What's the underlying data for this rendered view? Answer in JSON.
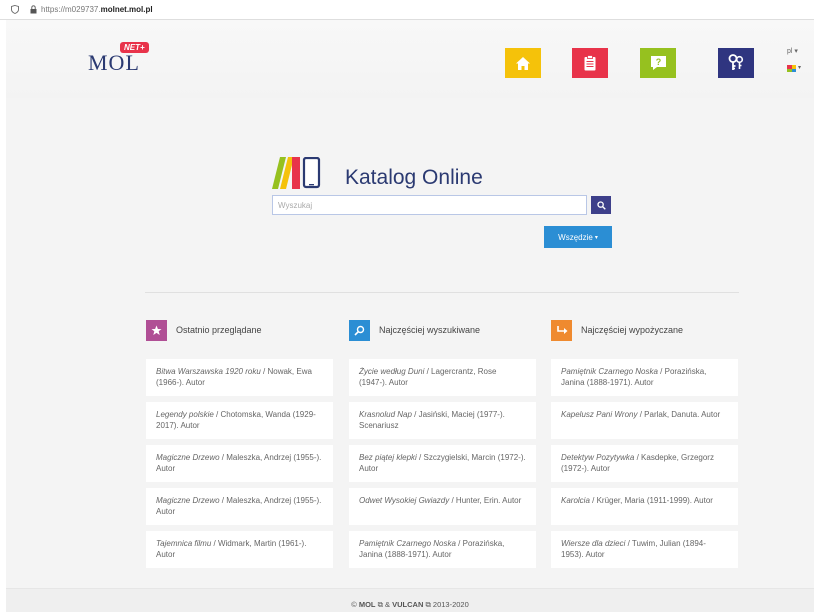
{
  "browser": {
    "url_prefix": "https://m029737.",
    "url_domain": "molnet.mol.pl"
  },
  "header": {
    "logo_text": "MOL",
    "logo_badge": "NET+",
    "language": "pl ▾"
  },
  "catalog": {
    "title": "Katalog Online",
    "search_placeholder": "Wyszukaj",
    "search_value": "",
    "scope_label": "Wszędzie",
    "scope_caret": "▾"
  },
  "sections": [
    {
      "title": "Ostatnio przeglądane",
      "icon": "star-icon",
      "color": "#b04f95",
      "items": [
        {
          "title": "Bitwa Warszawska 1920 roku",
          "rest": " / Nowak, Ewa (1966-). Autor"
        },
        {
          "title": "Legendy polskie",
          "rest": " / Chotomska, Wanda (1929-2017). Autor"
        },
        {
          "title": "Magiczne Drzewo",
          "rest": " / Maleszka, Andrzej (1955-). Autor"
        },
        {
          "title": "Magiczne Drzewo",
          "rest": " / Maleszka, Andrzej (1955-). Autor"
        },
        {
          "title": "Tajemnica filmu",
          "rest": " / Widmark, Martin (1961-). Autor"
        }
      ]
    },
    {
      "title": "Najczęściej wyszukiwane",
      "icon": "search-icon",
      "color": "#2b8ed4",
      "items": [
        {
          "title": "Życie według Duni",
          "rest": " / Lagercrantz, Rose (1947-). Autor"
        },
        {
          "title": "Krasnolud Nap",
          "rest": " / Jasiński, Maciej (1977-). Scenariusz"
        },
        {
          "title": "Bez piątej klepki",
          "rest": " / Szczygielski, Marcin (1972-). Autor"
        },
        {
          "title": "Odwet Wysokiej Gwiazdy",
          "rest": " / Hunter, Erin. Autor"
        },
        {
          "title": "Pamiętnik Czarnego Noska",
          "rest": " / Porazińska, Janina (1888-1971). Autor"
        }
      ]
    },
    {
      "title": "Najczęściej wypożyczane",
      "icon": "return-arrow-icon",
      "color": "#ef8a2f",
      "items": [
        {
          "title": "Pamiętnik Czarnego Noska",
          "rest": " / Porazińska, Janina (1888-1971). Autor"
        },
        {
          "title": "Kapelusz Pani Wrony",
          "rest": " / Parlak, Danuta. Autor"
        },
        {
          "title": "Detektyw Pozytywka",
          "rest": " / Kasdepke, Grzegorz (1972-). Autor"
        },
        {
          "title": "Karolcia",
          "rest": " / Krüger, Maria (1911-1999). Autor"
        },
        {
          "title": "Wiersze dla dzieci",
          "rest": " / Tuwim, Julian (1894-1953). Autor"
        }
      ]
    }
  ],
  "footer": {
    "prefix": "© ",
    "brand1": "MOL",
    "ext1": " ⧉ & ",
    "brand2": "VULCAN",
    "ext2": " ⧉ 2013-2020"
  },
  "colors": {
    "home": "#f5c20a",
    "clipboard": "#e8334a",
    "help": "#96c11f",
    "keys": "#2f3580",
    "primary": "#2b3a72",
    "accent": "#2b8ed4"
  }
}
